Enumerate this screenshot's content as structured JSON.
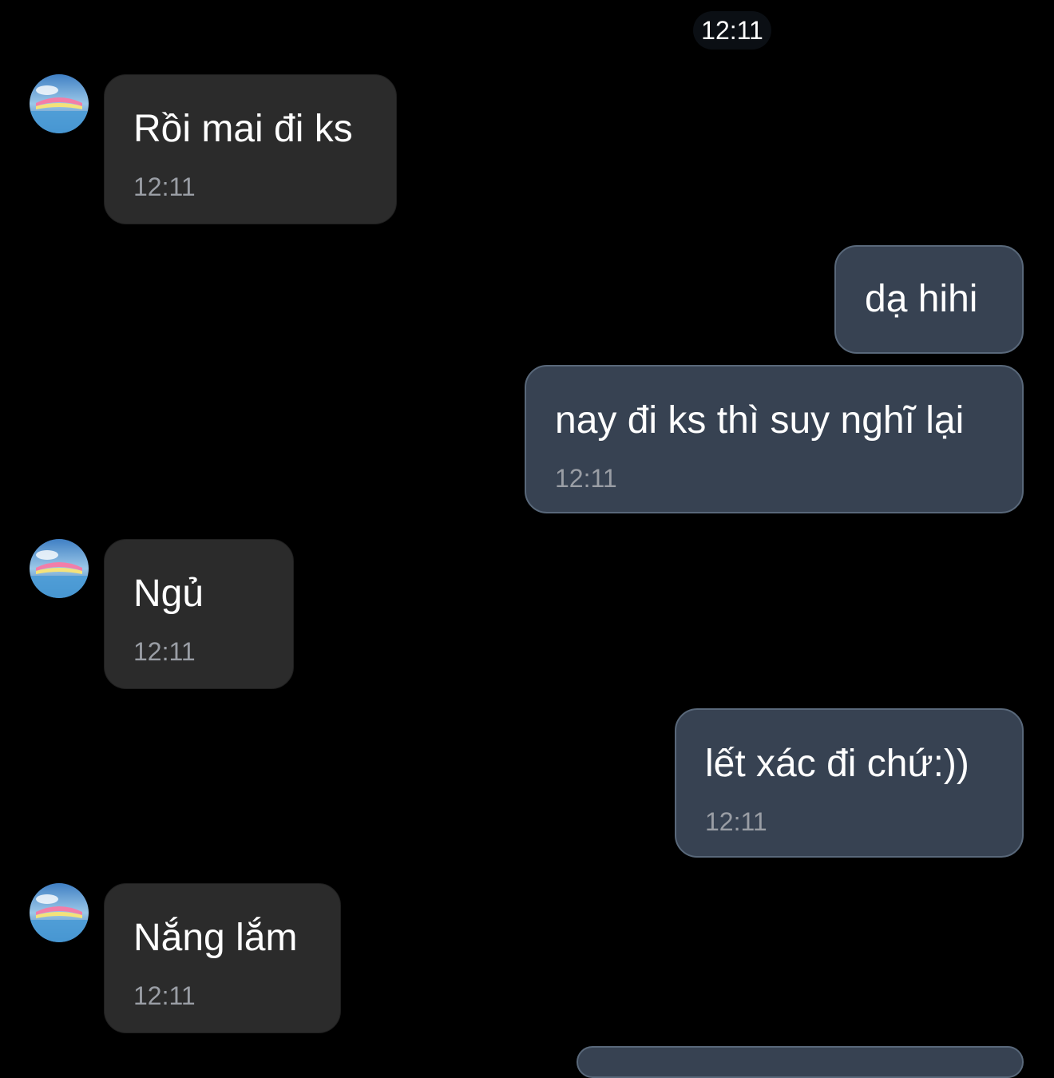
{
  "header": {
    "time": "12:11"
  },
  "messages": [
    {
      "direction": "in",
      "text": "Rồi mai đi ks",
      "time": "12:11",
      "avatar_icon": "contact-avatar"
    },
    {
      "direction": "out",
      "text": "dạ hihi",
      "time": ""
    },
    {
      "direction": "out",
      "text": "nay đi ks thì suy nghĩ lại",
      "time": "12:11"
    },
    {
      "direction": "in",
      "text": "Ngủ",
      "time": "12:11",
      "avatar_icon": "contact-avatar"
    },
    {
      "direction": "out",
      "text": "lết xác đi chứ:))",
      "time": "12:11"
    },
    {
      "direction": "in",
      "text": "Nắng lắm",
      "time": "12:11",
      "avatar_icon": "contact-avatar"
    }
  ],
  "colors": {
    "background": "#000000",
    "incoming_bubble": "#2b2b2b",
    "outgoing_bubble": "#374252",
    "outgoing_border": "#59687a",
    "timestamp": "#9a9ea5"
  }
}
